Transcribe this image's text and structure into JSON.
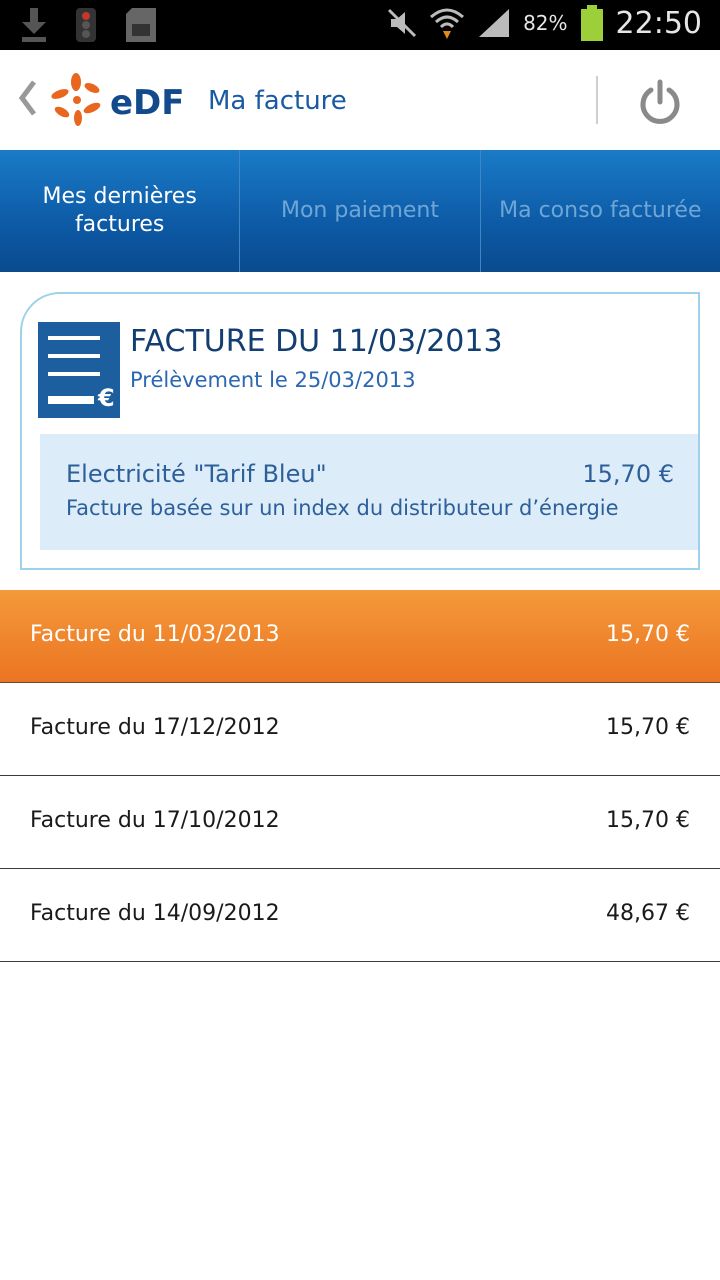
{
  "status_bar": {
    "battery_percent": "82%",
    "time": "22:50",
    "icons": [
      "download-icon",
      "traffic-light-icon",
      "sd-card-icon",
      "mute-icon",
      "wifi-icon",
      "signal-icon",
      "battery-icon"
    ]
  },
  "header": {
    "back_icon": "chevron-left-icon",
    "brand": "eDF",
    "title": "Ma facture",
    "power_icon": "power-icon"
  },
  "tabs": [
    {
      "label": "Mes dernières factures",
      "active": true
    },
    {
      "label": "Mon paiement",
      "active": false
    },
    {
      "label": "Ma conso facturée",
      "active": false
    }
  ],
  "invoice_card": {
    "title": "FACTURE DU 11/03/2013",
    "subtitle": "Prélèvement le 25/03/2013",
    "line_label": "Electricité \"Tarif Bleu\"",
    "line_amount": "15,70 €",
    "note": "Facture basée sur un index du distributeur d’énergie",
    "icon": "invoice-euro-icon"
  },
  "invoice_list": [
    {
      "label": "Facture du 11/03/2013",
      "amount": "15,70 €",
      "selected": true
    },
    {
      "label": "Facture du 17/12/2012",
      "amount": "15,70 €",
      "selected": false
    },
    {
      "label": "Facture du 17/10/2012",
      "amount": "15,70 €",
      "selected": false
    },
    {
      "label": "Facture du 14/09/2012",
      "amount": "48,67 €",
      "selected": false
    }
  ],
  "colors": {
    "accent_blue": "#0d5aa6",
    "accent_orange": "#ec7422",
    "light_blue_box": "#dcecf9"
  }
}
